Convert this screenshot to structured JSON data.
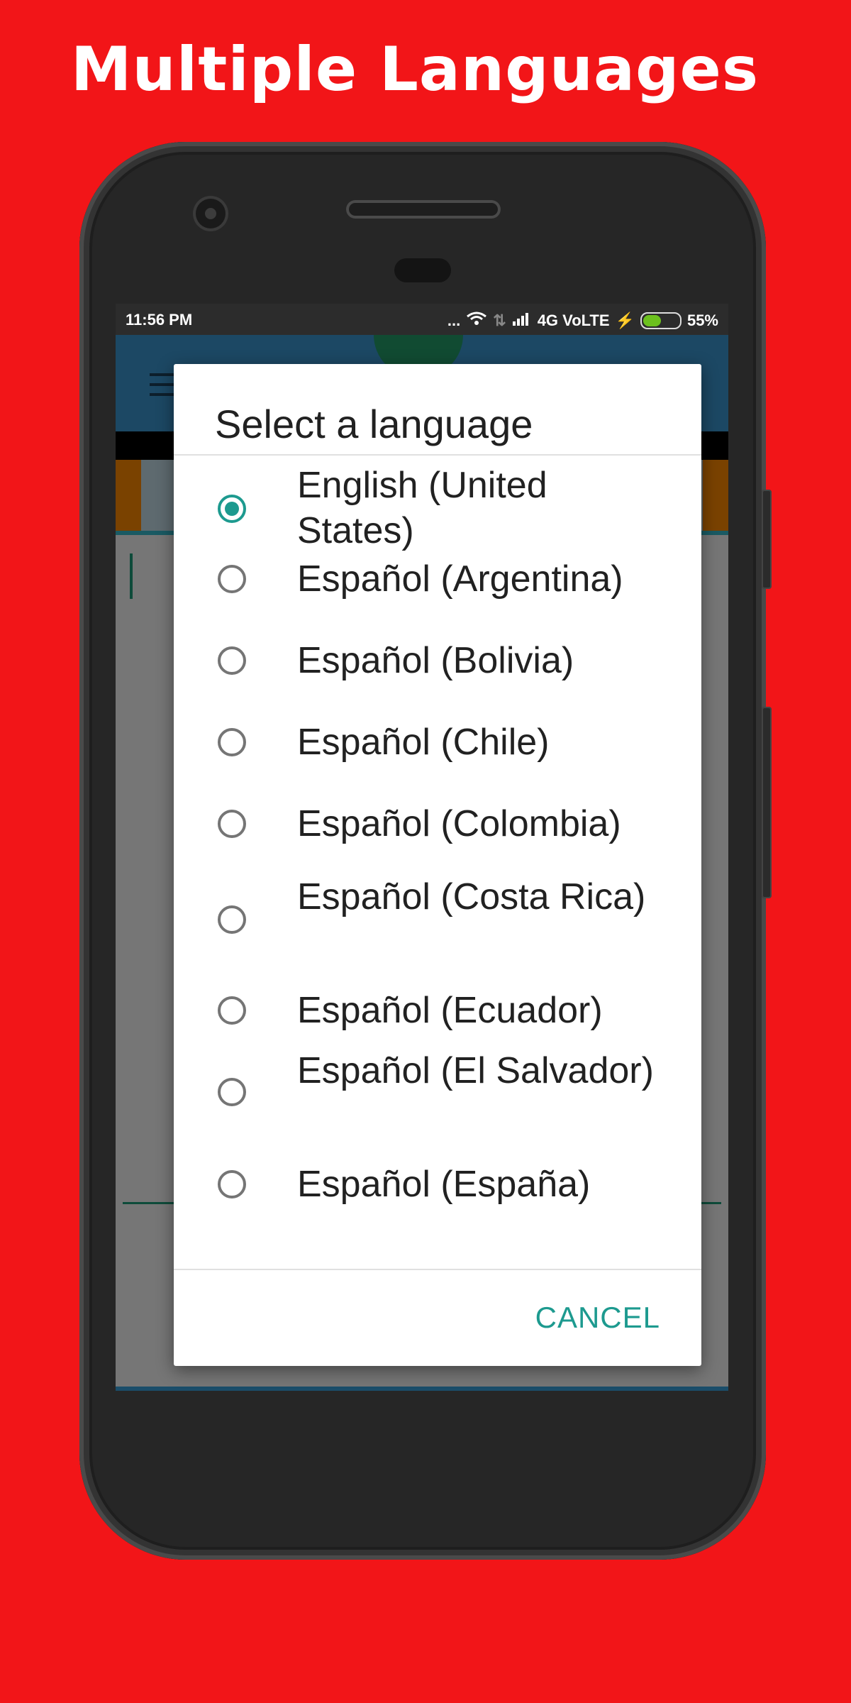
{
  "banner": {
    "title": "Multiple Languages"
  },
  "status_bar": {
    "time": "11:56 PM",
    "indicators": "... ",
    "network": "4G VoLTE",
    "battery": "55%",
    "battery_level_percent": 55
  },
  "dialog": {
    "title": "Select a language",
    "selected": "English (United States)",
    "options": [
      {
        "label": "English (United States)",
        "checked": true
      },
      {
        "label": "Español (Argentina)",
        "checked": false
      },
      {
        "label": "Español (Bolivia)",
        "checked": false
      },
      {
        "label": "Español (Chile)",
        "checked": false
      },
      {
        "label": "Español (Colombia)",
        "checked": false
      },
      {
        "label": "Español (Costa Rica)",
        "checked": false
      },
      {
        "label": "Español (Ecuador)",
        "checked": false
      },
      {
        "label": "Español (El Salvador)",
        "checked": false
      },
      {
        "label": "Español (España)",
        "checked": false
      }
    ],
    "cancel_label": "CANCEL"
  },
  "colors": {
    "background": "#f21518",
    "accent": "#1d9a8f",
    "app_bar": "#1c4864"
  }
}
